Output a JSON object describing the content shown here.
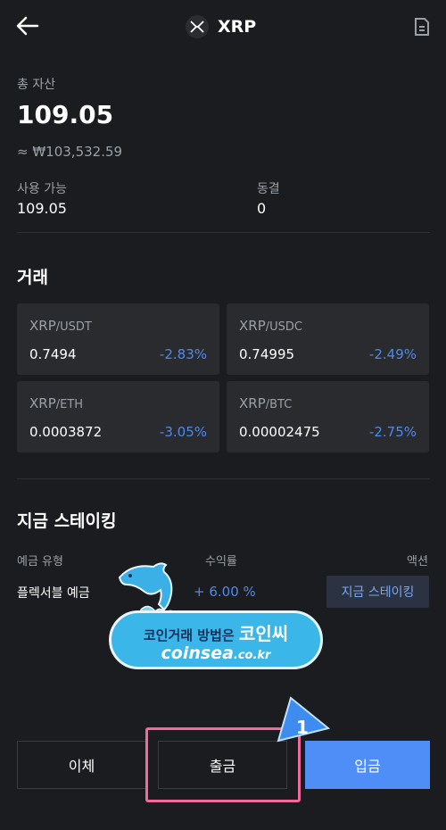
{
  "header": {
    "coin_name": "XRP",
    "back_icon": "back-arrow-icon",
    "coin_icon": "xrp-logo-icon",
    "doc_icon": "document-icon"
  },
  "balance": {
    "total_label": "총 자산",
    "total_value": "109.05",
    "krw_value": "≈ ₩103,532.59",
    "available_label": "사용 가능",
    "available_value": "109.05",
    "frozen_label": "동결",
    "frozen_value": "0"
  },
  "trade": {
    "title": "거래",
    "pairs": [
      {
        "base": "XRP",
        "quote": "/USDT",
        "price": "0.7494",
        "change": "-2.83%"
      },
      {
        "base": "XRP",
        "quote": "/USDC",
        "price": "0.74995",
        "change": "-2.49%"
      },
      {
        "base": "XRP",
        "quote": "/ETH",
        "price": "0.0003872",
        "change": "-3.05%"
      },
      {
        "base": "XRP",
        "quote": "/BTC",
        "price": "0.00002475",
        "change": "-2.75%"
      }
    ]
  },
  "staking": {
    "title": "지금 스테이킹",
    "col_type": "예금 유형",
    "col_rate": "수익률",
    "col_action": "액션",
    "row_type": "플렉서블 예금",
    "row_rate": "+ 6.00 %",
    "row_button": "지금 스테이킹"
  },
  "watermark": {
    "line1": "코인거래 방법은",
    "line1_big": "코인씨",
    "line2": "coinsea",
    "line2_small": ".co.kr"
  },
  "actions": {
    "transfer": "이체",
    "withdraw": "출금",
    "deposit": "입금"
  },
  "annotation": {
    "marker_number": "1"
  },
  "colors": {
    "background": "#1b1c1f",
    "accent_blue": "#4f8ef7",
    "highlight_pink": "#f06a9b"
  }
}
